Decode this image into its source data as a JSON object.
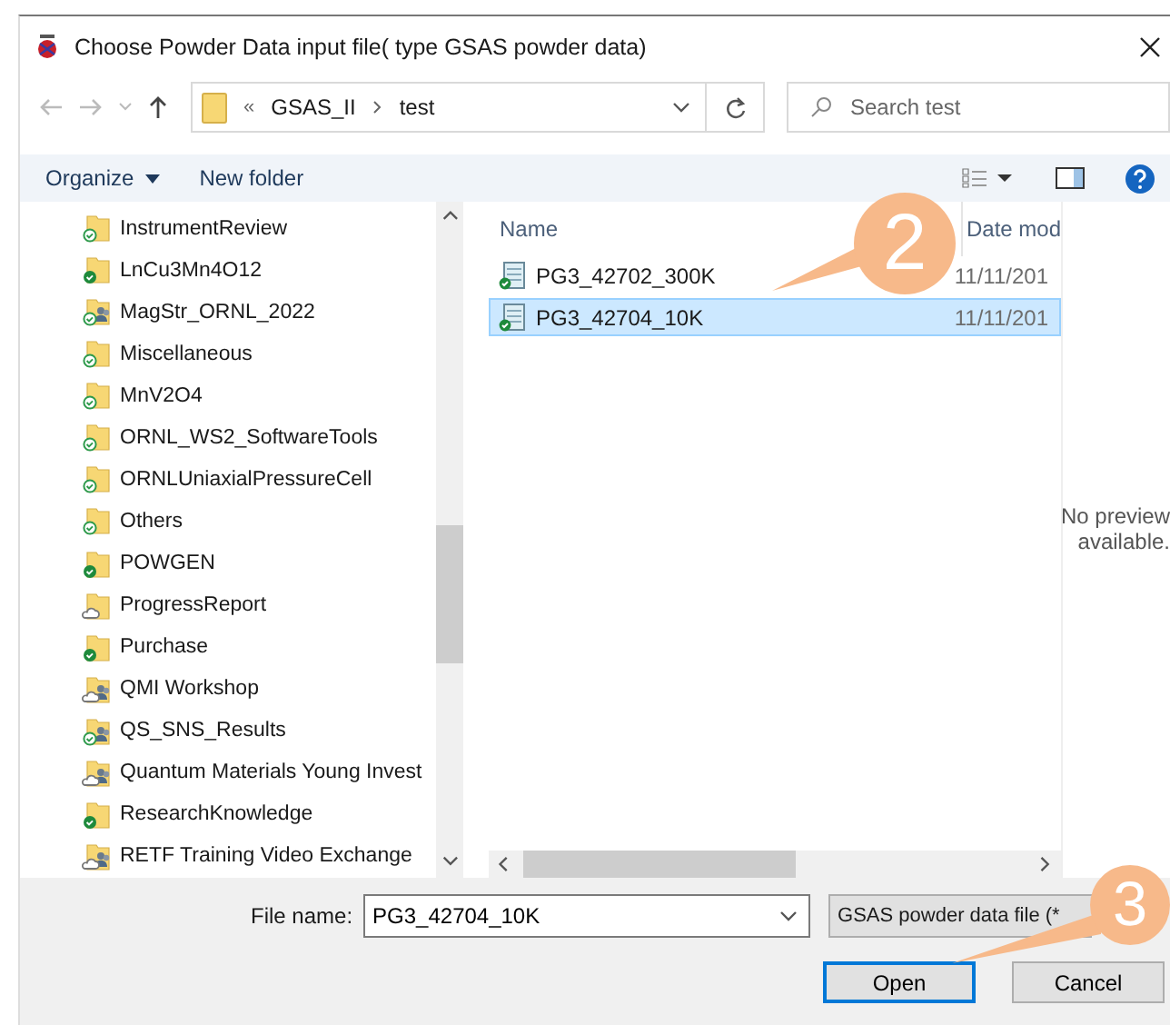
{
  "window": {
    "title": "Choose Powder Data input file( type GSAS powder data)"
  },
  "address": {
    "overflow": "«",
    "crumbs": [
      "GSAS_II",
      "test"
    ]
  },
  "search": {
    "placeholder": "Search test"
  },
  "toolbar": {
    "organize": "Organize",
    "new_folder": "New folder"
  },
  "sidebar": {
    "items": [
      {
        "label": "InstrumentReview",
        "shared": false,
        "always_on_device": false,
        "online_only": false
      },
      {
        "label": "LnCu3Mn4O12",
        "shared": false,
        "always_on_device": true,
        "online_only": false
      },
      {
        "label": "MagStr_ORNL_2022",
        "shared": true,
        "always_on_device": false,
        "online_only": false
      },
      {
        "label": "Miscellaneous",
        "shared": false,
        "always_on_device": false,
        "online_only": false
      },
      {
        "label": "MnV2O4",
        "shared": false,
        "always_on_device": false,
        "online_only": false
      },
      {
        "label": "ORNL_WS2_SoftwareTools",
        "shared": false,
        "always_on_device": false,
        "online_only": false
      },
      {
        "label": "ORNLUniaxialPressureCell",
        "shared": false,
        "always_on_device": false,
        "online_only": false
      },
      {
        "label": "Others",
        "shared": false,
        "always_on_device": false,
        "online_only": false
      },
      {
        "label": "POWGEN",
        "shared": false,
        "always_on_device": true,
        "online_only": false
      },
      {
        "label": "ProgressReport",
        "shared": false,
        "always_on_device": false,
        "online_only": true
      },
      {
        "label": "Purchase",
        "shared": false,
        "always_on_device": true,
        "online_only": false
      },
      {
        "label": "QMI Workshop",
        "shared": true,
        "always_on_device": false,
        "online_only": true
      },
      {
        "label": "QS_SNS_Results",
        "shared": true,
        "always_on_device": false,
        "online_only": false
      },
      {
        "label": "Quantum Materials Young Invest",
        "shared": true,
        "always_on_device": false,
        "online_only": true
      },
      {
        "label": "ResearchKnowledge",
        "shared": false,
        "always_on_device": true,
        "online_only": false
      },
      {
        "label": "RETF Training Video Exchange",
        "shared": true,
        "always_on_device": false,
        "online_only": true
      }
    ]
  },
  "files": {
    "columns": [
      "Name",
      "Date mod"
    ],
    "rows": [
      {
        "name": "PG3_42702_300K",
        "date": "11/11/201",
        "selected": false
      },
      {
        "name": "PG3_42704_10K",
        "date": "11/11/201",
        "selected": true
      }
    ]
  },
  "preview": {
    "lines": [
      "No preview",
      "available."
    ]
  },
  "file_name": {
    "label": "File name:",
    "value": "PG3_42704_10K"
  },
  "file_type": {
    "value": "GSAS powder data file (*"
  },
  "buttons": [
    {
      "label": "Open",
      "default": true
    },
    {
      "label": "Cancel",
      "default": false
    }
  ],
  "annotations": [
    {
      "label": "2"
    },
    {
      "label": "3"
    }
  ]
}
